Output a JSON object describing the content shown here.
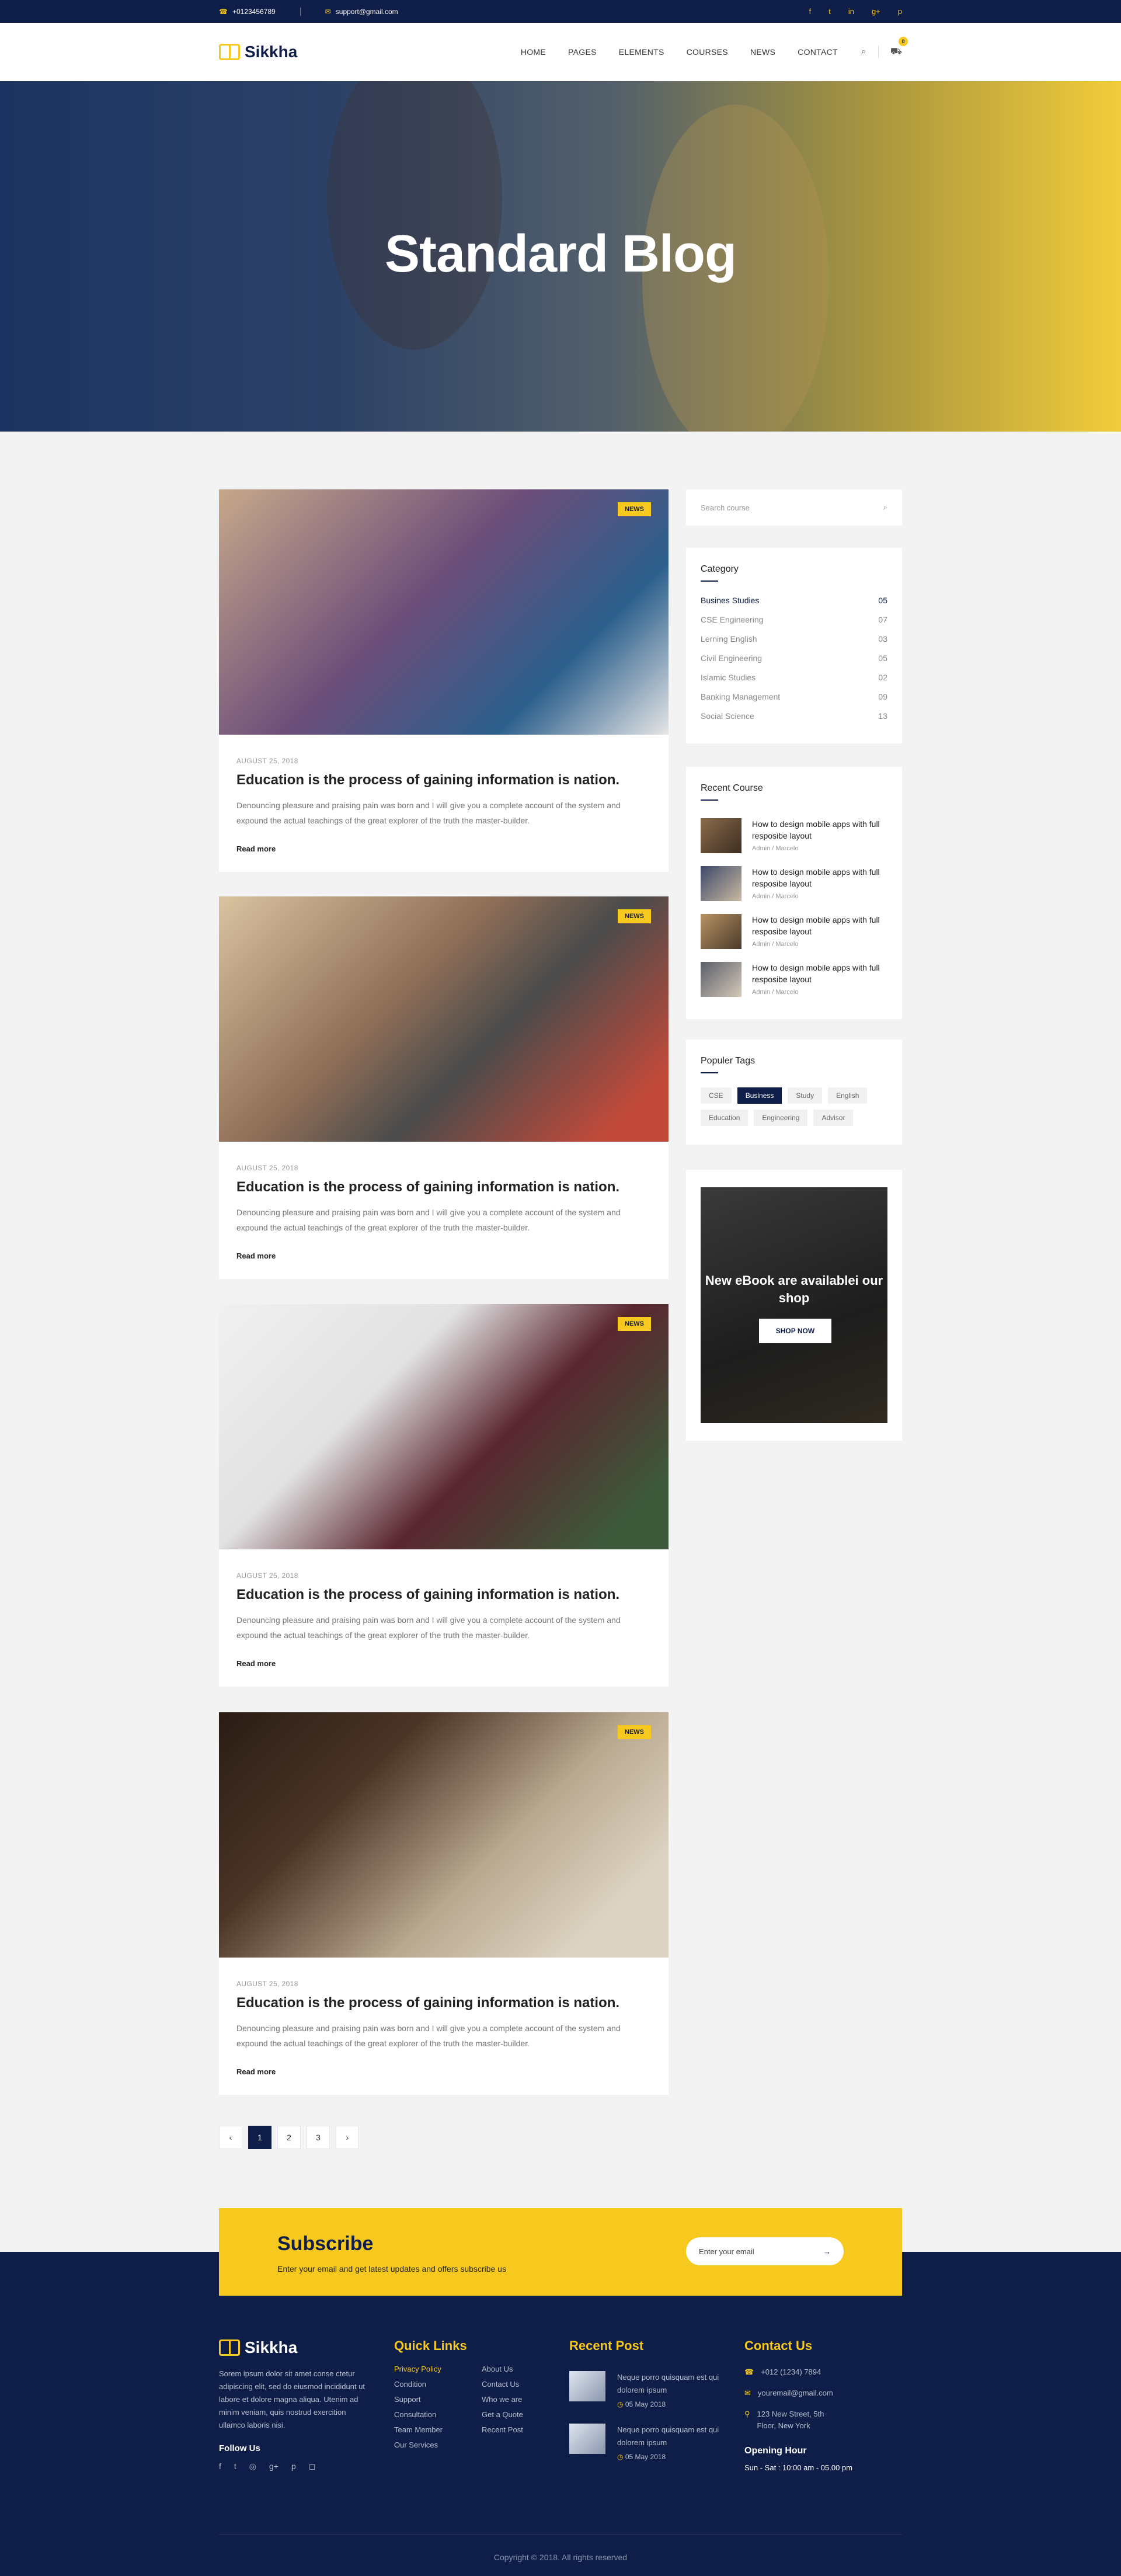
{
  "topbar": {
    "phone": "+0123456789",
    "email": "support@gmail.com",
    "social": [
      "f",
      "t",
      "in",
      "g+",
      "p"
    ]
  },
  "header": {
    "logo": "Sikkha",
    "nav": [
      "HOME",
      "PAGES",
      "ELEMENTS",
      "COURSES",
      "NEWS",
      "CONTACT"
    ],
    "cart_count": "0"
  },
  "hero": {
    "title": "Standard Blog"
  },
  "posts": [
    {
      "badge": "NEWS",
      "date": "AUGUST 25, 2018",
      "title": "Education is the process of gaining information is nation.",
      "excerpt": "Denouncing pleasure and praising pain was born and I will give you a complete account of the system and expound the actual teachings of the great explorer of the truth the master-builder.",
      "more": "Read more"
    },
    {
      "badge": "NEWS",
      "date": "AUGUST 25, 2018",
      "title": "Education is the process of gaining information is nation.",
      "excerpt": "Denouncing pleasure and praising pain was born and I will give you a complete account of the system and expound the actual teachings of the great explorer of the truth the master-builder.",
      "more": "Read more"
    },
    {
      "badge": "NEWS",
      "date": "AUGUST 25, 2018",
      "title": "Education is the process of gaining information is nation.",
      "excerpt": "Denouncing pleasure and praising pain was born and I will give you a complete account of the system and expound the actual teachings of the great explorer of the truth the master-builder.",
      "more": "Read more"
    },
    {
      "badge": "NEWS",
      "date": "AUGUST 25, 2018",
      "title": "Education is the process of gaining information is nation.",
      "excerpt": "Denouncing pleasure and praising pain was born and I will give you a complete account of the system and expound the actual teachings of the great explorer of the truth the master-builder.",
      "more": "Read more"
    }
  ],
  "pagination": {
    "prev": "‹",
    "pages": [
      "1",
      "2",
      "3"
    ],
    "next": "›",
    "active": "1"
  },
  "sidebar": {
    "search_placeholder": "Search course",
    "category_title": "Category",
    "categories": [
      {
        "name": "Busines Studies",
        "count": "05"
      },
      {
        "name": "CSE Engineering",
        "count": "07"
      },
      {
        "name": "Lerning English",
        "count": "03"
      },
      {
        "name": "Civil Engineering",
        "count": "05"
      },
      {
        "name": "Islamic Studies",
        "count": "02"
      },
      {
        "name": "Banking Management",
        "count": "09"
      },
      {
        "name": "Social Science",
        "count": "13"
      }
    ],
    "recent_title": "Recent Course",
    "recent": [
      {
        "title": "How to design mobile apps with full resposibe layout",
        "meta": "Admin / Marcelo"
      },
      {
        "title": "How to design mobile apps with full resposibe layout",
        "meta": "Admin / Marcelo"
      },
      {
        "title": "How to design mobile apps with full resposibe layout",
        "meta": "Admin / Marcelo"
      },
      {
        "title": "How to design mobile apps with full resposibe layout",
        "meta": "Admin / Marcelo"
      }
    ],
    "tags_title": "Populer Tags",
    "tags": [
      "CSE",
      "Business",
      "Study",
      "English",
      "Education",
      "Engineering",
      "Advisor"
    ],
    "active_tag": "Business",
    "promo_title": "New eBook are availablei our shop",
    "promo_button": "SHOP NOW"
  },
  "subscribe": {
    "title": "Subscribe",
    "text": "Enter your email and get latest updates and offers subscribe us",
    "placeholder": "Enter your email",
    "arrow": "→"
  },
  "footer": {
    "logo": "Sikkha",
    "about": "Sorem ipsum dolor sit amet conse ctetur adipiscing elit, sed do eiusmod incididunt ut labore et dolore magna aliqua. Utenim ad minim veniam, quis nostrud exercition ullamco laboris nisi.",
    "follow": "Follow Us",
    "social": [
      "f",
      "t",
      "◎",
      "g+",
      "p",
      "◻"
    ],
    "quick_title": "Quick Links",
    "quick_left": [
      "Privacy Policy",
      "Condition",
      "Support",
      "Consultation",
      "Team Member",
      "Our Services"
    ],
    "quick_right": [
      "About Us",
      "Contact Us",
      "Who we are",
      "Get a Quote",
      "Recent Post"
    ],
    "recent_title": "Recent Post",
    "recent": [
      {
        "title": "Neque porro quisquam est qui dolorem ipsum",
        "date": "05 May 2018"
      },
      {
        "title": "Neque porro quisquam est qui dolorem ipsum",
        "date": "05 May 2018"
      }
    ],
    "contact_title": "Contact Us",
    "phone": "+012 (1234) 7894",
    "email": "youremail@gmail.com",
    "address": "123 New Street, 5th Floor, New York",
    "hours_title": "Opening Hour",
    "hours": "Sun - Sat : 10:00 am - 05.00 pm",
    "copyright": "Copyright © 2018. All rights reserved"
  },
  "colors": {
    "navy": "#0e1e48",
    "accent": "#f7c81e"
  }
}
